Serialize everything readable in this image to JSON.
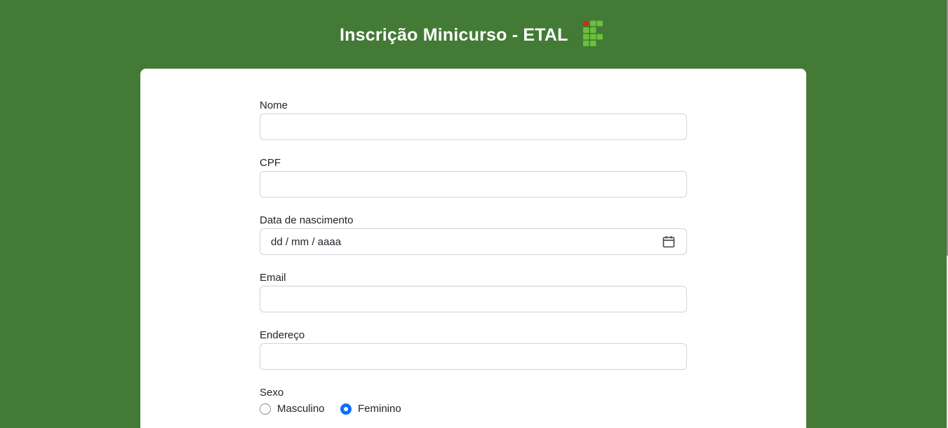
{
  "header": {
    "title": "Inscrição Minicurso - ETAL",
    "logo": "ifal-institute-logo"
  },
  "form": {
    "fields": [
      {
        "label": "Nome",
        "value": "",
        "type": "text"
      },
      {
        "label": "CPF",
        "value": "",
        "type": "text"
      },
      {
        "label": "Data de nascimento",
        "placeholder": "dd / mm / aaaa",
        "type": "date"
      },
      {
        "label": "Email",
        "value": "",
        "type": "email"
      },
      {
        "label": "Endereço",
        "value": "",
        "type": "text"
      }
    ],
    "sexo": {
      "label": "Sexo",
      "options": [
        {
          "label": "Masculino",
          "checked": false
        },
        {
          "label": "Feminino",
          "checked": true
        }
      ]
    }
  },
  "colors": {
    "background": "#437a36",
    "card": "#ffffff",
    "radio_accent": "#0d6efd",
    "logo_green": "#6abf3c",
    "logo_red": "#d9261c"
  }
}
